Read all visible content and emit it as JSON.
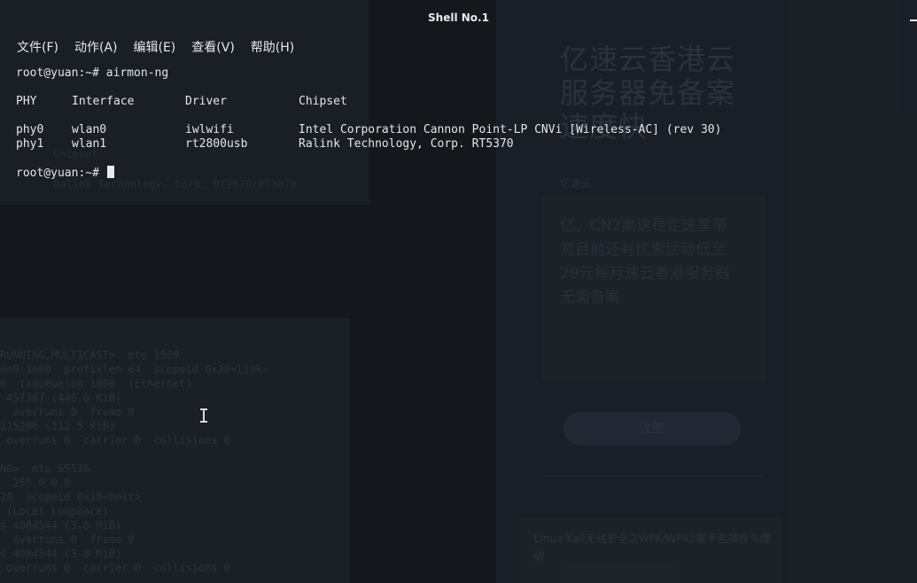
{
  "window": {
    "title": "Shell No.1"
  },
  "menu": [
    {
      "label": "文件(F)"
    },
    {
      "label": "动作(A)"
    },
    {
      "label": "编辑(E)"
    },
    {
      "label": "查看(V)"
    },
    {
      "label": "帮助(H)"
    }
  ],
  "terminal": {
    "prompt_command": "root@yuan:~# airmon-ng",
    "prompt": "root@yuan:~# ",
    "headers": [
      "PHY",
      "Interface",
      "Driver",
      "Chipset"
    ],
    "rows": [
      [
        "phy0",
        "wlan0",
        "iwlwifi",
        "Intel Corporation Cannon Point-LP CNVi [Wireless-AC] (rev 30)"
      ],
      [
        "phy1",
        "wlan1",
        "rt2800usb",
        "Ralink Technology, Corp. RT5370"
      ]
    ]
  },
  "background": {
    "headline": "亿速云香港云服务器免备案速度快",
    "small_label": "亿速云",
    "paragraph": "亿，CN2高速稳定速享带宽目前还有优惠活动低至29元每月速云香港服务器无需备案",
    "button": "注册",
    "card_text": "Linux Kali无线安全之WPA/WPA2握手包捕获与爆破",
    "ghost_chipset_label": "Chipset",
    "ghost_chipset_value": "Ralink Technology, Corp. RT2870/RT3070",
    "ifconfig_lines": [
      "RUNNING,MULTICAST>  mtu 1500",
      "ee9:1e00  prefixlen 64  scopeid 0x20<link>",
      "0  txqueuelen 1000  (Ethernet)",
      " 457387 (446.6 KiB)",
      "  overruns 0  frame 0",
      "115280 (112.5 KiB)",
      " overruns 0  carrier 0  collisions 0",
      "",
      "NG>  mtu 65536",
      "  255.0.0.0",
      "28  scopeid 0x10<host>",
      " (Local Loopback)",
      "s 4084544 (3.8 MiB)",
      "  overruns 0  frame 0",
      "s 4084544 (3.8 MiB)",
      " overruns 0  carrier 0  collisions 0"
    ]
  }
}
